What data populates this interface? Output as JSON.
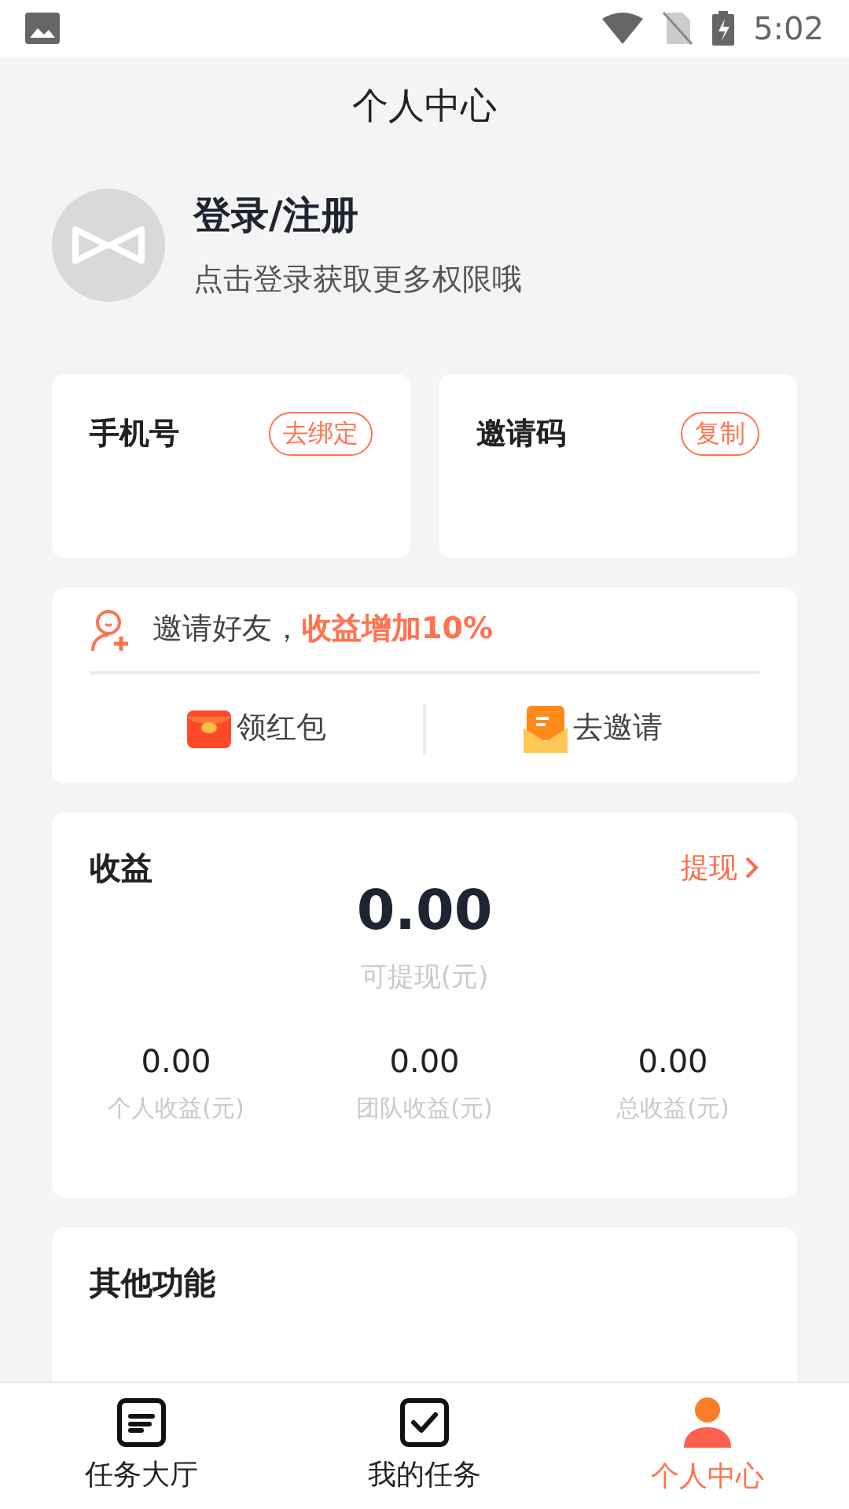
{
  "status_bar": {
    "time": "5:02"
  },
  "header": {
    "title": "个人中心"
  },
  "profile": {
    "name": "登录/注册",
    "subtitle": "点击登录获取更多权限哦"
  },
  "info_cards": [
    {
      "label": "手机号",
      "action": "去绑定"
    },
    {
      "label": "邀请码",
      "action": "复制"
    }
  ],
  "invite": {
    "text": "邀请好友，**收益增加10%**",
    "actions": [
      {
        "kind": "red-packet",
        "label": "领红包"
      },
      {
        "kind": "envelope",
        "label": "去邀请"
      }
    ]
  },
  "earnings": {
    "title": "收益",
    "link": "提现",
    "amount": "0.00",
    "amount_label": "可提现(元)",
    "stats": [
      {
        "value": "0.00",
        "label": "个人收益(元)"
      },
      {
        "value": "0.00",
        "label": "团队收益(元)"
      },
      {
        "value": "0.00",
        "label": "总收益(元)"
      }
    ]
  },
  "other": {
    "title": "其他功能"
  },
  "tab_bar": [
    {
      "kind": "list",
      "label": "任务大厅",
      "selected": false
    },
    {
      "kind": "check",
      "label": "我的任务",
      "selected": false
    },
    {
      "kind": "person",
      "label": "个人中心",
      "selected": true
    }
  ]
}
